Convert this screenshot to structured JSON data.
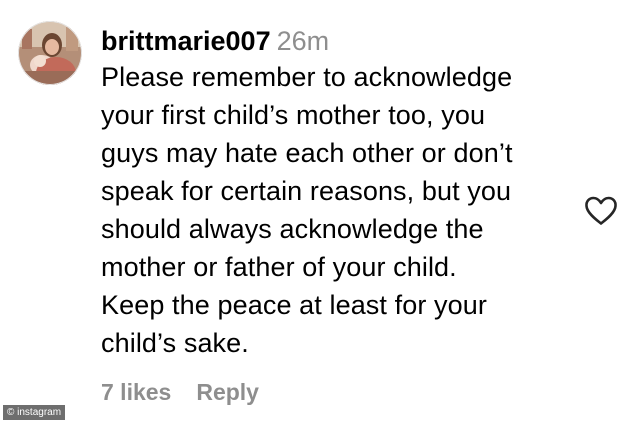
{
  "comment": {
    "username": "brittmarie007",
    "timestamp": "26m",
    "lines": [
      "Please remember to acknowledge",
      "your first child’s mother too, you",
      "guys may hate each other or don’t",
      "speak for certain reasons, but you",
      "should always acknowledge the",
      "mother or father of your child.",
      "Keep the peace at least for your",
      "child’s sake."
    ],
    "likes": "7 likes",
    "reply_label": "Reply"
  },
  "icons": {
    "like": "heart-outline-icon",
    "avatar": "user-avatar"
  },
  "watermark": "© instagram",
  "colors": {
    "text": "#000000",
    "muted": "#8e8e8e",
    "watermark_bg": "#6e6e6e"
  }
}
